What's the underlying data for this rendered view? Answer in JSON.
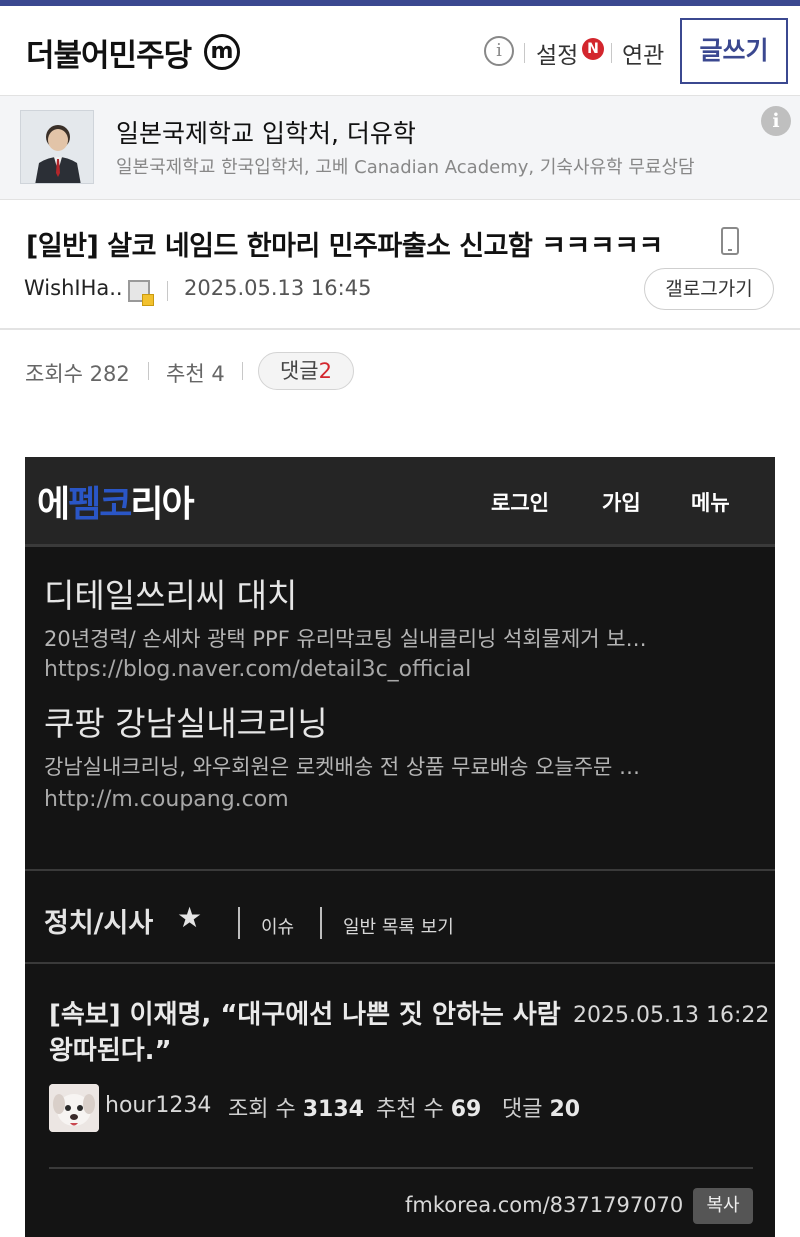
{
  "header": {
    "gallery_title": "더불어민주당",
    "minor_badge": "m",
    "info_icon": "i",
    "settings_label": "설정",
    "settings_badge": "N",
    "related_label": "연관",
    "write_button": "글쓰기"
  },
  "ad": {
    "title": "일본국제학교 입학처, 더유학",
    "description": "일본국제학교 한국입학처, 고베 Canadian Academy, 기숙사유학 무료상담",
    "info_icon": "i"
  },
  "post": {
    "title": "[일반] 살코 네임드 한마리 민주파출소 신고함 ㅋㅋㅋㅋㅋ",
    "author": "WishIHa..",
    "date": "2025.05.13 16:45",
    "gallery_button": "갤로그가기",
    "views_label": "조회수 282",
    "recommend_label": "추천 4",
    "comments_label": "댓글",
    "comments_count": "2"
  },
  "embed": {
    "logo_part1": "에",
    "logo_part2": "펨",
    "logo_part3": "코",
    "logo_part4": "리아",
    "nav_login": "로그인",
    "nav_join": "가입",
    "nav_menu": "메뉴",
    "results": [
      {
        "title": "디테일쓰리씨 대치",
        "desc": "20년경력/ 손세차 광택 PPF 유리막코팅 실내클리닝 석회물제거 보…",
        "url": "https://blog.naver.com/detail3c_official"
      },
      {
        "title": "쿠팡 강남실내크리닝",
        "desc": "강남실내크리닝, 와우회원은 로켓배송 전 상품 무료배송 오늘주문 …",
        "url": "http://m.coupang.com"
      }
    ],
    "category": "정치/시사",
    "category_links": [
      "이슈",
      "일반 목록 보기"
    ],
    "news": {
      "headline": "[속보] 이재명, “대구에선 나쁜 짓 안하는 사람 왕따된다.”",
      "date": "2025.05.13 16:22",
      "author": "hour1234",
      "views_label": "조회 수",
      "views": "3134",
      "recommend_label": "추천 수",
      "recommend": "69",
      "comments_label": "댓글",
      "comments": "20"
    },
    "share_url": "fmkorea.com/8371797070",
    "copy_button": "복사"
  },
  "colors": {
    "brand": "#3b4890",
    "badge_red": "#d3262d",
    "embed_bg": "#141414"
  }
}
